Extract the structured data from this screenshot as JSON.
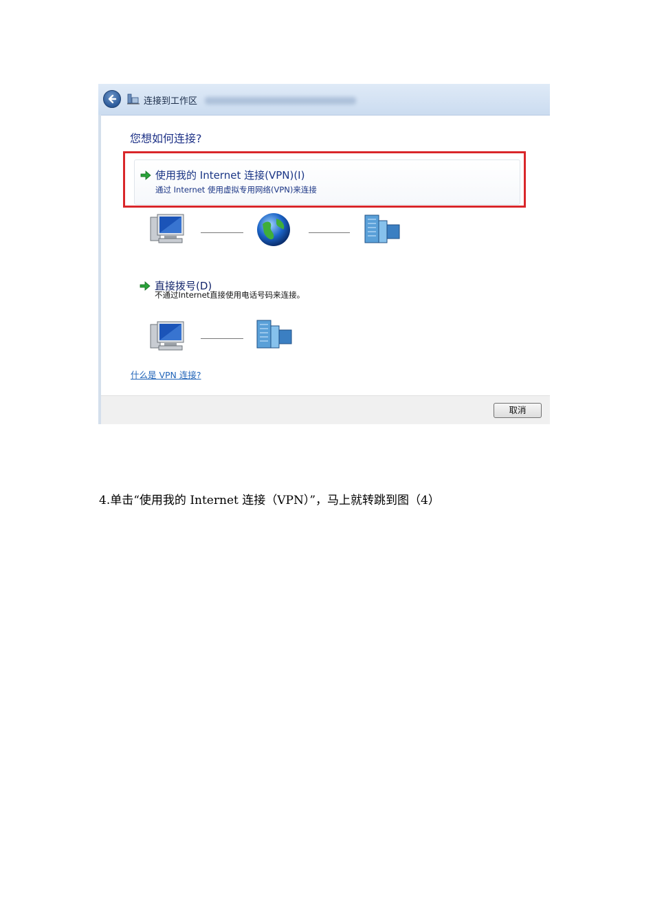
{
  "window": {
    "title": "连接到工作区",
    "back_icon": "back-arrow-icon",
    "title_icon": "network-workplace-icon"
  },
  "main": {
    "heading": "您想如何连接?",
    "options": [
      {
        "title": "使用我的 Internet 连接(VPN)(I)",
        "description": "通过 Internet 使用虚拟专用网络(VPN)来连接",
        "icon": "green-arrow-icon",
        "highlighted": true,
        "diagram": [
          "computer-icon",
          "globe-icon",
          "server-icon"
        ]
      },
      {
        "title": "直接拨号(D)",
        "description": "不通过Internet直接使用电话号码来连接。",
        "icon": "green-arrow-icon",
        "diagram": [
          "computer-icon",
          "server-icon"
        ]
      }
    ],
    "help_link": "什么是 VPN 连接?"
  },
  "footer": {
    "cancel_label": "取消"
  },
  "caption": "4.单击“使用我的 Internet 连接（VPN）”，马上就转跳到图（4）",
  "colors": {
    "highlight_border": "#d9262a",
    "heading_text": "#1e3287",
    "link": "#1f63b8"
  }
}
